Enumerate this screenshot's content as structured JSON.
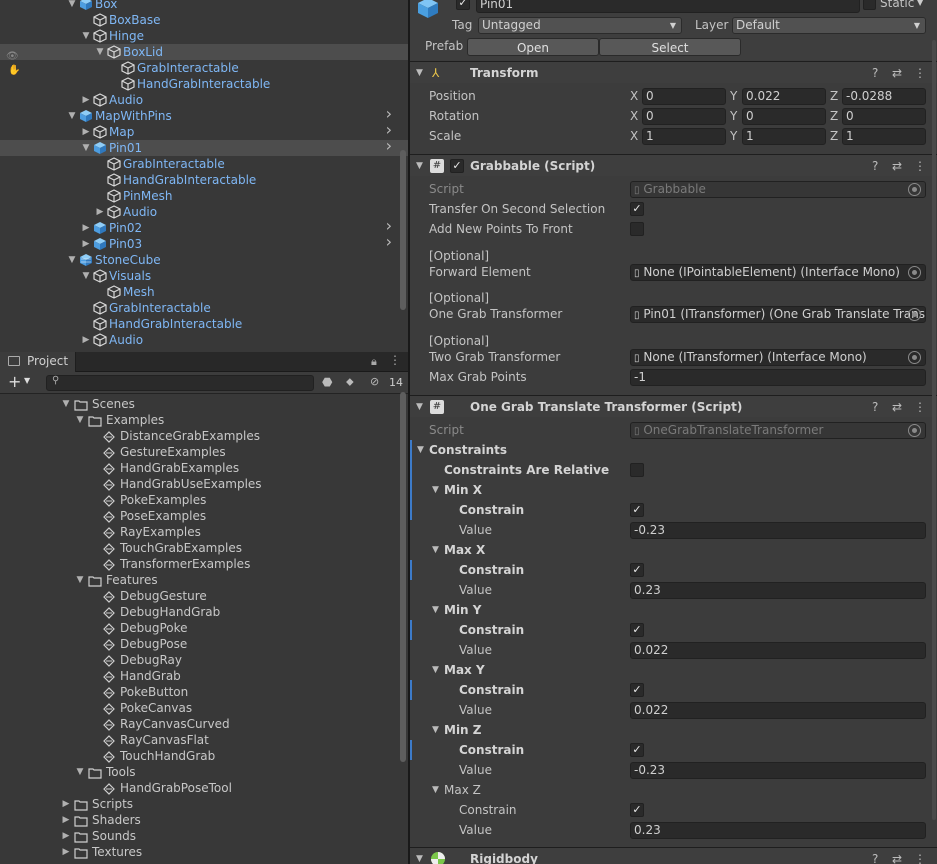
{
  "hierarchy": {
    "items": [
      {
        "label": "Box",
        "indent": 0,
        "arrow": "open",
        "icon": "cube-blue",
        "blue": true
      },
      {
        "label": "BoxBase",
        "indent": 1,
        "arrow": "",
        "icon": "cube",
        "blue": true
      },
      {
        "label": "Hinge",
        "indent": 1,
        "arrow": "open",
        "icon": "cube",
        "blue": true
      },
      {
        "label": "BoxLid",
        "indent": 2,
        "arrow": "open",
        "icon": "cube",
        "blue": true,
        "sel": true
      },
      {
        "label": "GrabInteractable",
        "indent": 3,
        "arrow": "",
        "icon": "cube",
        "blue": true
      },
      {
        "label": "HandGrabInteractable",
        "indent": 3,
        "arrow": "",
        "icon": "cube",
        "blue": true
      },
      {
        "label": "Audio",
        "indent": 1,
        "arrow": "closed",
        "icon": "cube",
        "blue": true
      },
      {
        "label": "MapWithPins",
        "indent": 0,
        "arrow": "open",
        "icon": "cube-blue",
        "blue": true,
        "chev": true
      },
      {
        "label": "Map",
        "indent": 1,
        "arrow": "closed",
        "icon": "cube",
        "blue": true,
        "chev": true
      },
      {
        "label": "Pin01",
        "indent": 1,
        "arrow": "open",
        "icon": "cube-blue",
        "blue": true,
        "chev": true,
        "sel": true
      },
      {
        "label": "GrabInteractable",
        "indent": 2,
        "arrow": "",
        "icon": "cube",
        "blue": true
      },
      {
        "label": "HandGrabInteractable",
        "indent": 2,
        "arrow": "",
        "icon": "cube",
        "blue": true
      },
      {
        "label": "PinMesh",
        "indent": 2,
        "arrow": "",
        "icon": "cube",
        "blue": true
      },
      {
        "label": "Audio",
        "indent": 2,
        "arrow": "closed",
        "icon": "cube",
        "blue": true
      },
      {
        "label": "Pin02",
        "indent": 1,
        "arrow": "closed",
        "icon": "cube-blue",
        "blue": true,
        "chev": true
      },
      {
        "label": "Pin03",
        "indent": 1,
        "arrow": "closed",
        "icon": "cube-blue",
        "blue": true,
        "chev": true
      },
      {
        "label": "StoneCube",
        "indent": 0,
        "arrow": "open",
        "icon": "cube-stripe",
        "blue": true
      },
      {
        "label": "Visuals",
        "indent": 1,
        "arrow": "open",
        "icon": "cube",
        "blue": true
      },
      {
        "label": "Mesh",
        "indent": 2,
        "arrow": "",
        "icon": "cube",
        "blue": true
      },
      {
        "label": "GrabInteractable",
        "indent": 1,
        "arrow": "",
        "icon": "cube",
        "blue": true
      },
      {
        "label": "HandGrabInteractable",
        "indent": 1,
        "arrow": "",
        "icon": "cube",
        "blue": true
      },
      {
        "label": "Audio",
        "indent": 1,
        "arrow": "closed",
        "icon": "cube",
        "blue": true
      }
    ]
  },
  "project": {
    "tab_label": "Project",
    "add_label": "+",
    "hidden_count": "14",
    "tree": [
      {
        "label": "Scenes",
        "indent": 0,
        "arrow": "open",
        "icon": "folder"
      },
      {
        "label": "Examples",
        "indent": 1,
        "arrow": "open",
        "icon": "folder"
      },
      {
        "label": "DistanceGrabExamples",
        "indent": 2,
        "arrow": "",
        "icon": "scene"
      },
      {
        "label": "GestureExamples",
        "indent": 2,
        "arrow": "",
        "icon": "scene"
      },
      {
        "label": "HandGrabExamples",
        "indent": 2,
        "arrow": "",
        "icon": "scene"
      },
      {
        "label": "HandGrabUseExamples",
        "indent": 2,
        "arrow": "",
        "icon": "scene"
      },
      {
        "label": "PokeExamples",
        "indent": 2,
        "arrow": "",
        "icon": "scene"
      },
      {
        "label": "PoseExamples",
        "indent": 2,
        "arrow": "",
        "icon": "scene"
      },
      {
        "label": "RayExamples",
        "indent": 2,
        "arrow": "",
        "icon": "scene"
      },
      {
        "label": "TouchGrabExamples",
        "indent": 2,
        "arrow": "",
        "icon": "scene"
      },
      {
        "label": "TransformerExamples",
        "indent": 2,
        "arrow": "",
        "icon": "scene"
      },
      {
        "label": "Features",
        "indent": 1,
        "arrow": "open",
        "icon": "folder"
      },
      {
        "label": "DebugGesture",
        "indent": 2,
        "arrow": "",
        "icon": "scene"
      },
      {
        "label": "DebugHandGrab",
        "indent": 2,
        "arrow": "",
        "icon": "scene"
      },
      {
        "label": "DebugPoke",
        "indent": 2,
        "arrow": "",
        "icon": "scene"
      },
      {
        "label": "DebugPose",
        "indent": 2,
        "arrow": "",
        "icon": "scene"
      },
      {
        "label": "DebugRay",
        "indent": 2,
        "arrow": "",
        "icon": "scene"
      },
      {
        "label": "HandGrab",
        "indent": 2,
        "arrow": "",
        "icon": "scene"
      },
      {
        "label": "PokeButton",
        "indent": 2,
        "arrow": "",
        "icon": "scene"
      },
      {
        "label": "PokeCanvas",
        "indent": 2,
        "arrow": "",
        "icon": "scene"
      },
      {
        "label": "RayCanvasCurved",
        "indent": 2,
        "arrow": "",
        "icon": "scene"
      },
      {
        "label": "RayCanvasFlat",
        "indent": 2,
        "arrow": "",
        "icon": "scene"
      },
      {
        "label": "TouchHandGrab",
        "indent": 2,
        "arrow": "",
        "icon": "scene"
      },
      {
        "label": "Tools",
        "indent": 1,
        "arrow": "open",
        "icon": "folder"
      },
      {
        "label": "HandGrabPoseTool",
        "indent": 2,
        "arrow": "",
        "icon": "scene"
      },
      {
        "label": "Scripts",
        "indent": 0,
        "arrow": "closed",
        "icon": "folder"
      },
      {
        "label": "Shaders",
        "indent": 0,
        "arrow": "closed",
        "icon": "folder"
      },
      {
        "label": "Sounds",
        "indent": 0,
        "arrow": "closed",
        "icon": "folder"
      },
      {
        "label": "Textures",
        "indent": 0,
        "arrow": "closed",
        "icon": "folder"
      }
    ]
  },
  "inspector": {
    "object_name": "Pin01",
    "static_label": "Static",
    "tag_label": "Tag",
    "tag_value": "Untagged",
    "layer_label": "Layer",
    "layer_value": "Default",
    "prefab_label": "Prefab",
    "open_label": "Open",
    "select_label": "Select",
    "transform": {
      "title": "Transform",
      "rows": [
        {
          "label": "Position",
          "x": "0",
          "y": "0.022",
          "z": "-0.0288"
        },
        {
          "label": "Rotation",
          "x": "0",
          "y": "0",
          "z": "0"
        },
        {
          "label": "Scale",
          "x": "1",
          "y": "1",
          "z": "1"
        }
      ],
      "axis_x": "X",
      "axis_y": "Y",
      "axis_z": "Z"
    },
    "grabbable": {
      "title": "Grabbable (Script)",
      "script_label": "Script",
      "script_value": "Grabbable",
      "transfer_label": "Transfer On Second Selection",
      "add_points_label": "Add New Points To Front",
      "optional": "[Optional]",
      "forward_label": "Forward Element",
      "forward_value": "None (IPointableElement) (Interface Mono)",
      "one_grab_label": "One Grab Transformer",
      "one_grab_value": "Pin01 (ITransformer) (One Grab Translate Trans",
      "two_grab_label": "Two Grab Transformer",
      "two_grab_value": "None (ITransformer) (Interface Mono)",
      "max_points_label": "Max Grab Points",
      "max_points_value": "-1"
    },
    "translate": {
      "title": "One Grab Translate Transformer (Script)",
      "script_label": "Script",
      "script_value": "OneGrabTranslateTransformer",
      "constraints_label": "Constraints",
      "relative_label": "Constraints Are Relative",
      "constrain_label": "Constrain",
      "value_label": "Value",
      "groups": [
        {
          "name": "Min X",
          "value": "-0.23",
          "bold": true
        },
        {
          "name": "Max X",
          "value": "0.23",
          "bold": true
        },
        {
          "name": "Min Y",
          "value": "0.022",
          "bold": true
        },
        {
          "name": "Max Y",
          "value": "0.022",
          "bold": true
        },
        {
          "name": "Min Z",
          "value": "-0.23",
          "bold": true
        },
        {
          "name": "Max Z",
          "value": "0.23",
          "bold": false
        }
      ]
    },
    "rigidbody": {
      "title": "Rigidbody"
    },
    "check_mark": "✓"
  }
}
